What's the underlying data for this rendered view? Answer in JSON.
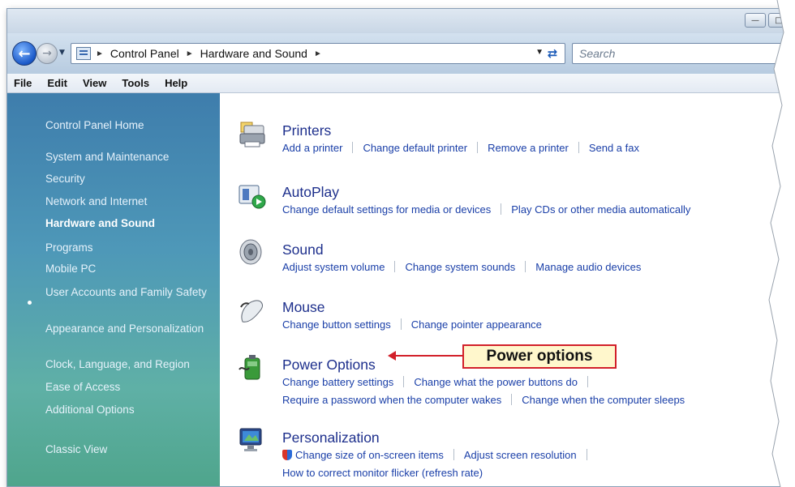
{
  "window": {
    "controls": [
      "minimize",
      "maximize"
    ]
  },
  "navigation": {
    "breadcrumbs": [
      "Control Panel",
      "Hardware and Sound"
    ],
    "search_placeholder": "Search"
  },
  "menu": [
    "File",
    "Edit",
    "View",
    "Tools",
    "Help"
  ],
  "sidebar": {
    "home": "Control Panel Home",
    "items": [
      {
        "label": "System and Maintenance"
      },
      {
        "label": "Security"
      },
      {
        "label": "Network and Internet"
      },
      {
        "label": "Hardware and Sound",
        "active": true
      },
      {
        "label": "Programs"
      },
      {
        "label": "Mobile PC"
      },
      {
        "label": "User Accounts and Family Safety"
      },
      {
        "label": "Appearance and Personalization"
      },
      {
        "label": "Clock, Language, and Region"
      },
      {
        "label": "Ease of Access"
      },
      {
        "label": "Additional Options"
      }
    ],
    "classic_view": "Classic View"
  },
  "categories": [
    {
      "title": "Printers",
      "icon": "printer-icon",
      "links": [
        "Add a printer",
        "Change default printer",
        "Remove a printer",
        "Send a fax"
      ]
    },
    {
      "title": "AutoPlay",
      "icon": "autoplay-icon",
      "links": [
        "Change default settings for media or devices",
        "Play CDs or other media automatically"
      ]
    },
    {
      "title": "Sound",
      "icon": "speaker-icon",
      "links": [
        "Adjust system volume",
        "Change system sounds",
        "Manage audio devices"
      ]
    },
    {
      "title": "Mouse",
      "icon": "mouse-icon",
      "links": [
        "Change button settings",
        "Change pointer appearance"
      ]
    },
    {
      "title": "Power Options",
      "icon": "battery-icon",
      "links": [
        "Change battery settings",
        "Change what the power buttons do"
      ],
      "links2": [
        "Require a password when the computer wakes",
        "Change when the computer sleeps"
      ]
    },
    {
      "title": "Personalization",
      "icon": "monitor-icon",
      "links": [
        "Change size of on-screen items",
        "Adjust screen resolution"
      ],
      "links2": [
        "How to correct monitor flicker (refresh rate)"
      ]
    }
  ],
  "callout": {
    "label": "Power options",
    "color": "#d2202a"
  }
}
